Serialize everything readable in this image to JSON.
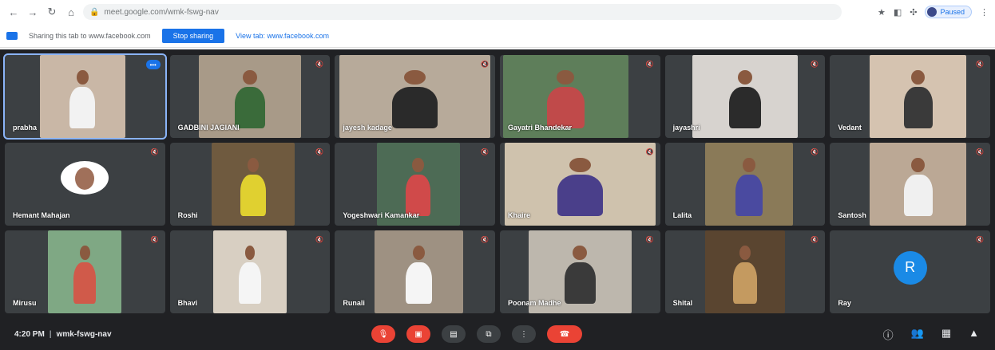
{
  "browser": {
    "url": "meet.google.com/wmk-fswg-nav",
    "profile_label": "Paused"
  },
  "share": {
    "text": "Sharing this tab to www.facebook.com",
    "stop_label": "Stop sharing",
    "view_label": "View tab: www.facebook.com"
  },
  "meeting": {
    "time": "4:20 PM",
    "code": "wmk-fswg-nav",
    "participants": [
      {
        "name": "prabha",
        "kind": "video",
        "bg": "#c9b7a6",
        "fg": "#f2f2f2"
      },
      {
        "name": "GADBINI JAGIANI",
        "kind": "video",
        "bg": "#a89a88",
        "fg": "#3a6b3a"
      },
      {
        "name": "jayesh kadage",
        "kind": "video",
        "bg": "#b7aa9a",
        "fg": "#2a2a2a"
      },
      {
        "name": "Gayatri Bhandekar",
        "kind": "video",
        "bg": "#5e7e5a",
        "fg": "#c04a4a"
      },
      {
        "name": "jayashri",
        "kind": "video",
        "bg": "#d7d3cf",
        "fg": "#2b2b2b"
      },
      {
        "name": "Vedant",
        "kind": "video",
        "bg": "#d5c3b0",
        "fg": "#3a3a3a"
      },
      {
        "name": "Hemant Mahajan",
        "kind": "avatar",
        "bg": "",
        "fg": ""
      },
      {
        "name": "Roshi",
        "kind": "video",
        "bg": "#6f5a3f",
        "fg": "#e0d030"
      },
      {
        "name": "Yogeshwari Kamankar",
        "kind": "video",
        "bg": "#4d6b55",
        "fg": "#d04a4a"
      },
      {
        "name": "Khaire",
        "kind": "video",
        "bg": "#cfc2ad",
        "fg": "#4a3f8a"
      },
      {
        "name": "Lalita",
        "kind": "video",
        "bg": "#8a7a58",
        "fg": "#4a4aa0"
      },
      {
        "name": "Santosh",
        "kind": "video",
        "bg": "#bba895",
        "fg": "#f0f0f0"
      },
      {
        "name": "Mirusu",
        "kind": "video",
        "bg": "#7fa884",
        "fg": "#d05a4a"
      },
      {
        "name": "Bhavi",
        "kind": "video",
        "bg": "#d8cfc2",
        "fg": "#f5f5f5"
      },
      {
        "name": "Runali",
        "kind": "video",
        "bg": "#9e9182",
        "fg": "#f5f5f5"
      },
      {
        "name": "Poonam Madhe",
        "kind": "video",
        "bg": "#bdb7ad",
        "fg": "#3a3a3a"
      },
      {
        "name": "Shital",
        "kind": "video",
        "bg": "#5a4530",
        "fg": "#c49a60"
      },
      {
        "name": "Ray",
        "kind": "letter",
        "letter": "R",
        "bg": "",
        "fg": ""
      }
    ]
  },
  "colors": {
    "meet_bg": "#202124",
    "tile_bg": "#3c4043",
    "accent": "#1a73e8",
    "danger": "#ea4335"
  }
}
